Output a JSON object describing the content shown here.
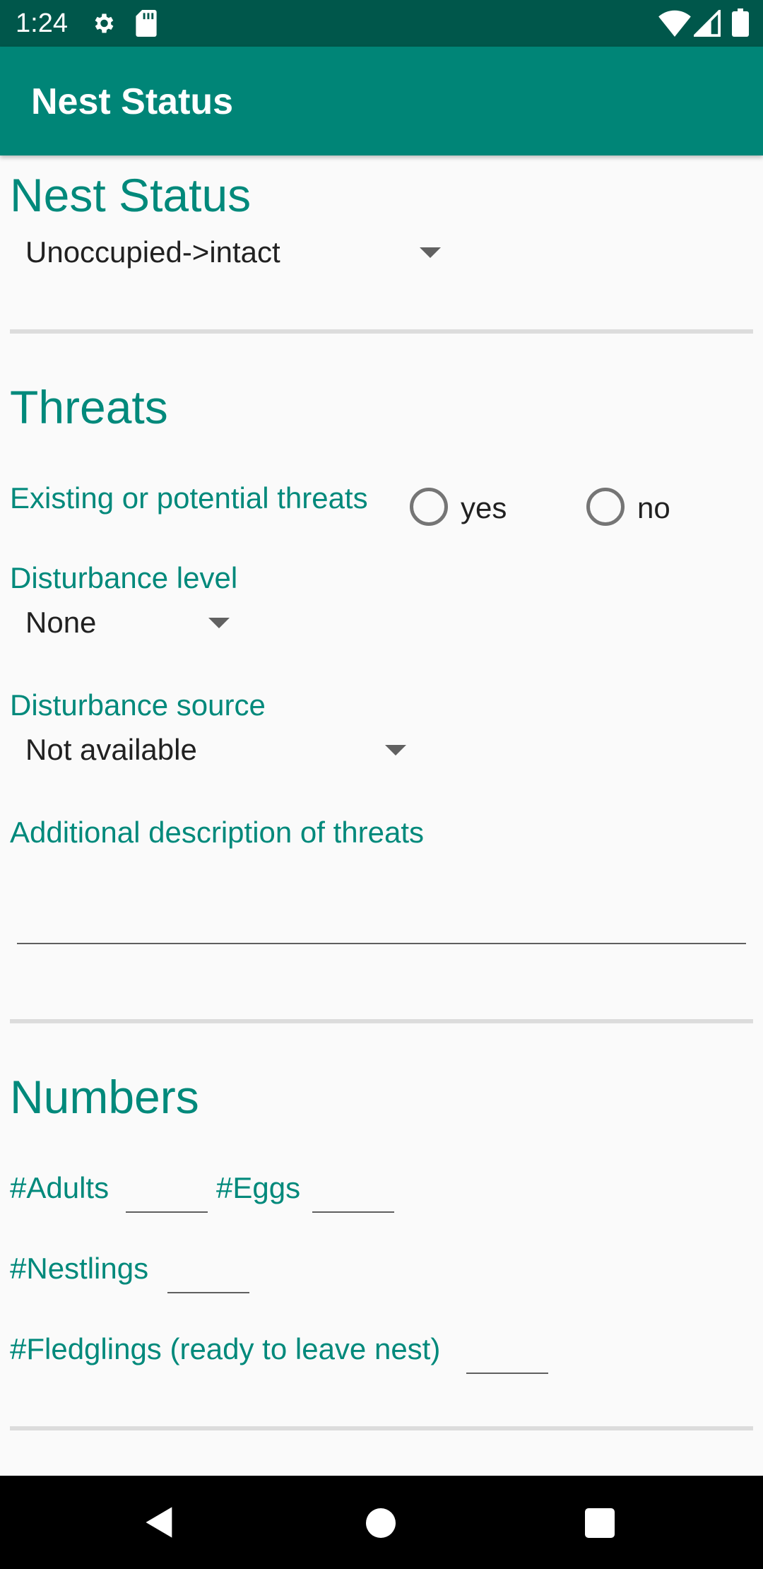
{
  "status_bar": {
    "time": "1:24",
    "icons": [
      "gear-icon",
      "sd-card-icon",
      "wifi-icon",
      "signal-icon",
      "battery-icon"
    ]
  },
  "app_bar": {
    "title": "Nest Status"
  },
  "nest_status": {
    "heading": "Nest Status",
    "selected": "Unoccupied->intact"
  },
  "threats": {
    "heading": "Threats",
    "existing_label": "Existing or potential threats",
    "yes_label": "yes",
    "no_label": "no",
    "disturbance_level_label": "Disturbance level",
    "disturbance_level_value": "None",
    "disturbance_source_label": "Disturbance source",
    "disturbance_source_value": "Not available",
    "description_label": "Additional description of threats",
    "description_value": ""
  },
  "numbers": {
    "heading": "Numbers",
    "adults_label": "#Adults",
    "adults_value": "",
    "eggs_label": "#Eggs",
    "eggs_value": "",
    "nestlings_label": "#Nestlings",
    "nestlings_value": "",
    "fledglings_label": "#Fledglings (ready to leave nest)",
    "fledglings_value": ""
  },
  "colors": {
    "status_bar": "#00574b",
    "app_bar": "#008577",
    "accent_text": "#00897b",
    "nav_bar": "#000000"
  }
}
